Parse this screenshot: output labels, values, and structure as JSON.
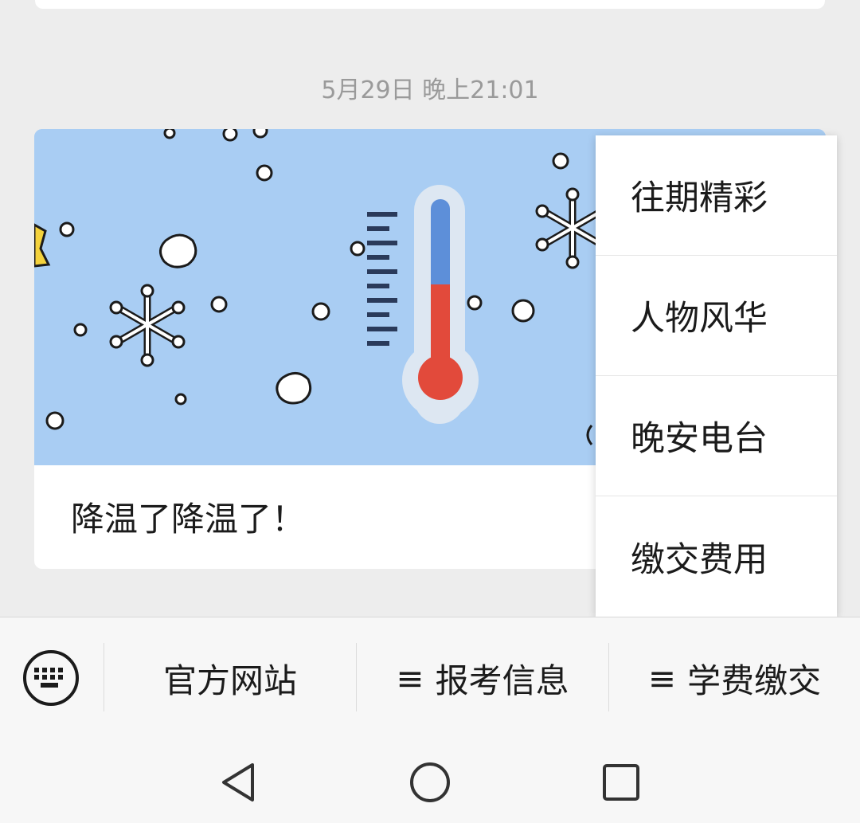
{
  "chat": {
    "timestamp": "5月29日 晚上21:01",
    "article": {
      "title": "降温了降温了！",
      "cover_icon": "thermometer-snow-illustration"
    }
  },
  "popup_menu": {
    "items": [
      "往期精彩",
      "人物风华",
      "晚安电台",
      "缴交费用"
    ]
  },
  "bottom_menu": {
    "keyboard_icon": "keyboard-icon",
    "menu_glyph": "≡",
    "tabs": [
      {
        "label": "官方网站",
        "has_submenu": false
      },
      {
        "label": "报考信息",
        "has_submenu": true
      },
      {
        "label": "学费缴交",
        "has_submenu": true
      }
    ]
  },
  "nav_bar": {
    "back_icon": "back-triangle-icon",
    "home_icon": "home-circle-icon",
    "recents_icon": "recents-square-icon"
  },
  "colors": {
    "background": "#ededed",
    "cover_sky": "#a9cdf3",
    "thermometer_red": "#e24a3b",
    "thermometer_blue": "#5d8fd9"
  }
}
